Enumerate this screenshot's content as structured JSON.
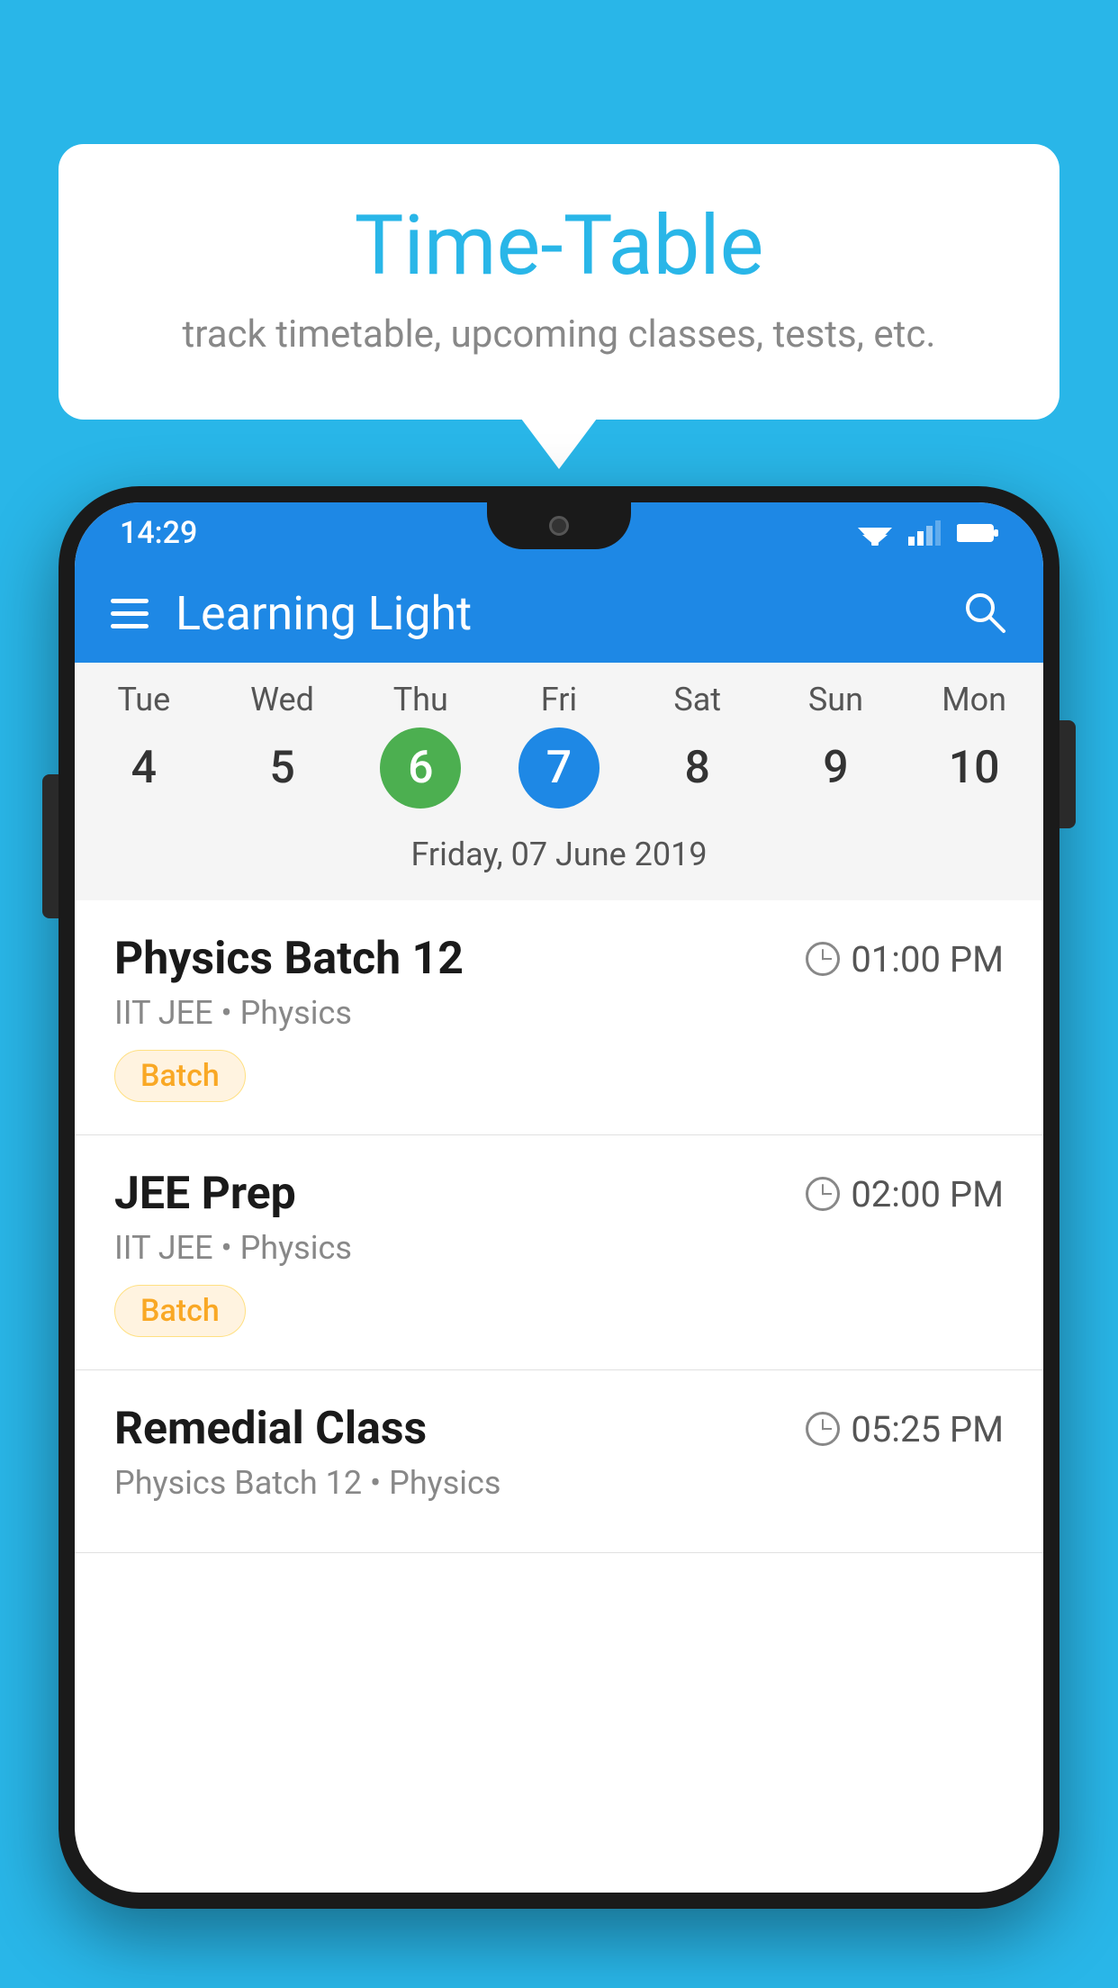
{
  "background_color": "#29b6e8",
  "speech_bubble": {
    "title": "Time-Table",
    "subtitle": "track timetable, upcoming classes, tests, etc."
  },
  "phone": {
    "status_bar": {
      "time": "14:29"
    },
    "app_bar": {
      "title": "Learning Light"
    },
    "calendar": {
      "days": [
        {
          "name": "Tue",
          "num": "4",
          "state": "normal"
        },
        {
          "name": "Wed",
          "num": "5",
          "state": "normal"
        },
        {
          "name": "Thu",
          "num": "6",
          "state": "today"
        },
        {
          "name": "Fri",
          "num": "7",
          "state": "selected"
        },
        {
          "name": "Sat",
          "num": "8",
          "state": "normal"
        },
        {
          "name": "Sun",
          "num": "9",
          "state": "normal"
        },
        {
          "name": "Mon",
          "num": "10",
          "state": "normal"
        }
      ],
      "selected_date": "Friday, 07 June 2019"
    },
    "schedule": [
      {
        "title": "Physics Batch 12",
        "time": "01:00 PM",
        "sub": "IIT JEE • Physics",
        "badge": "Batch"
      },
      {
        "title": "JEE Prep",
        "time": "02:00 PM",
        "sub": "IIT JEE • Physics",
        "badge": "Batch"
      },
      {
        "title": "Remedial Class",
        "time": "05:25 PM",
        "sub": "Physics Batch 12 • Physics",
        "badge": null
      }
    ]
  }
}
